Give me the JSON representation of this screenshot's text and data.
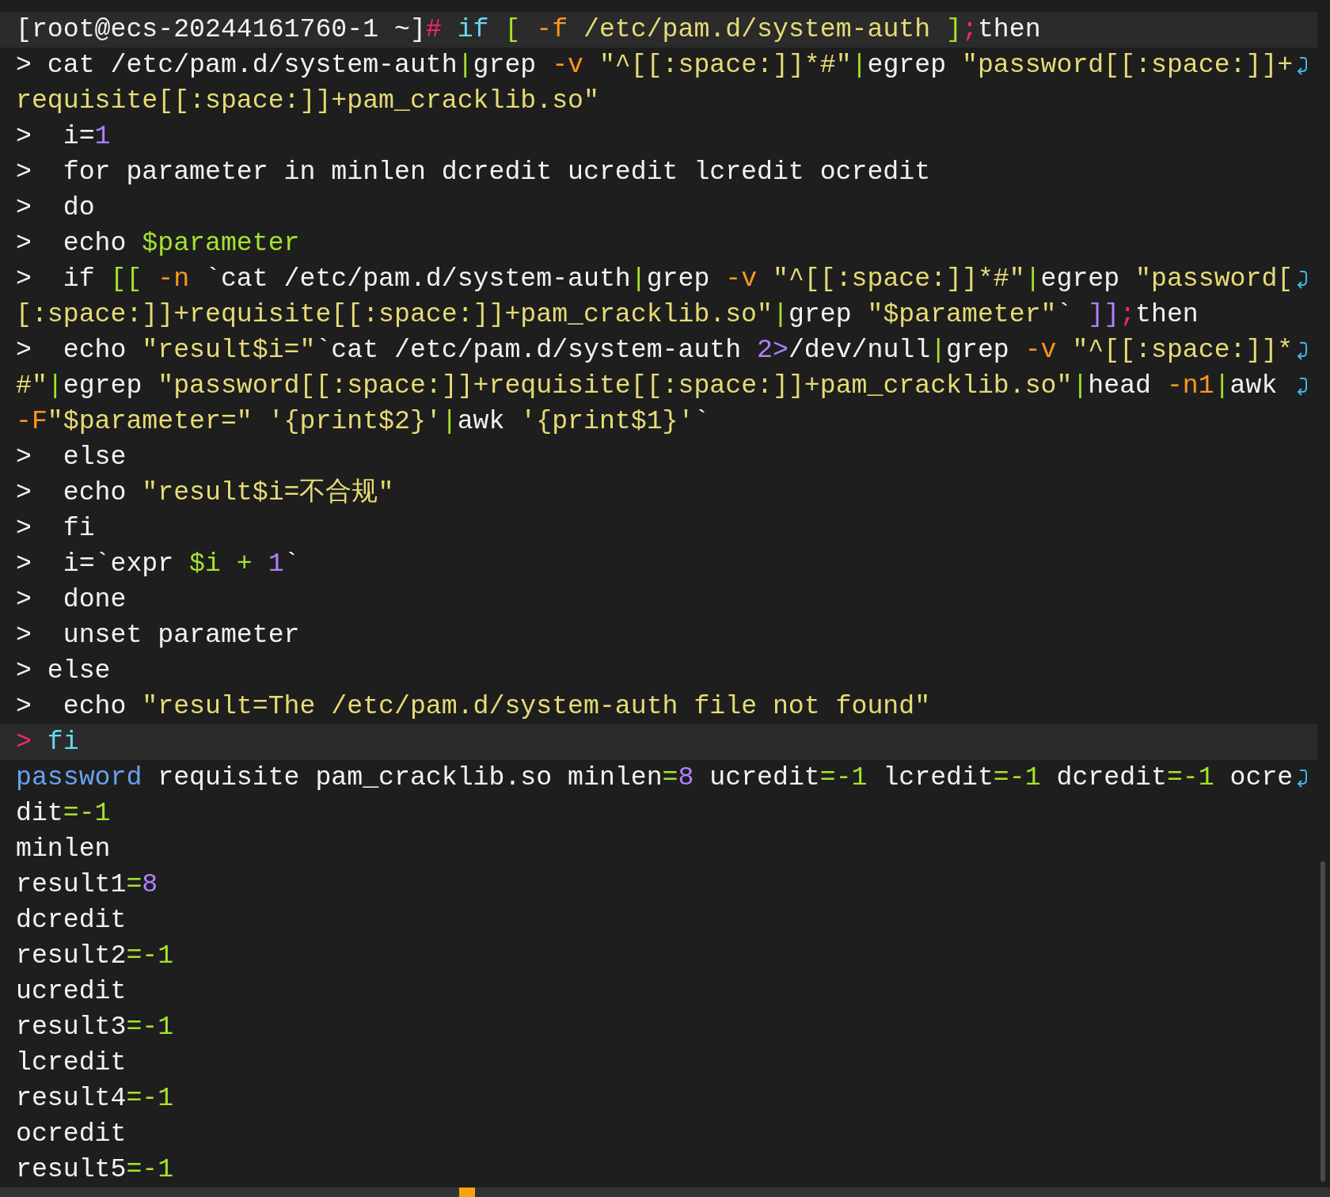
{
  "terminal": {
    "lines": [
      {
        "highlighted": true,
        "wrapped": false,
        "segments": [
          {
            "kind": "text",
            "text": "[root@ecs-20244161760-1 ~]"
          },
          {
            "kind": "punct",
            "text": "# "
          },
          {
            "kind": "keyword",
            "text": "if "
          },
          {
            "kind": "operator",
            "text": "[ "
          },
          {
            "kind": "option",
            "text": "-f "
          },
          {
            "kind": "string",
            "text": "/etc/pam.d/system-auth "
          },
          {
            "kind": "operator",
            "text": "]"
          },
          {
            "kind": "punct",
            "text": ";"
          },
          {
            "kind": "text",
            "text": "then"
          }
        ]
      },
      {
        "highlighted": false,
        "wrapped": true,
        "segments": [
          {
            "kind": "text",
            "text": "> cat /etc/pam.d/system-auth"
          },
          {
            "kind": "operator",
            "text": "|"
          },
          {
            "kind": "text",
            "text": "grep "
          },
          {
            "kind": "option",
            "text": "-v "
          },
          {
            "kind": "string",
            "text": "\"^[[:space:]]*#\""
          },
          {
            "kind": "operator",
            "text": "|"
          },
          {
            "kind": "text",
            "text": "egrep "
          },
          {
            "kind": "string",
            "text": "\"password[[:space:]]+"
          }
        ]
      },
      {
        "highlighted": false,
        "wrapped": false,
        "segments": [
          {
            "kind": "string",
            "text": "requisite[[:space:]]+pam_cracklib.so\""
          }
        ]
      },
      {
        "highlighted": false,
        "wrapped": false,
        "segments": [
          {
            "kind": "text",
            "text": ">  i="
          },
          {
            "kind": "number",
            "text": "1"
          }
        ]
      },
      {
        "highlighted": false,
        "wrapped": false,
        "segments": [
          {
            "kind": "text",
            "text": ">  for parameter in minlen dcredit ucredit lcredit ocredit"
          }
        ]
      },
      {
        "highlighted": false,
        "wrapped": false,
        "segments": [
          {
            "kind": "text",
            "text": ">  do"
          }
        ]
      },
      {
        "highlighted": false,
        "wrapped": false,
        "segments": [
          {
            "kind": "text",
            "text": ">  echo "
          },
          {
            "kind": "operator",
            "text": "$parameter"
          }
        ]
      },
      {
        "highlighted": false,
        "wrapped": true,
        "segments": [
          {
            "kind": "text",
            "text": ">  if "
          },
          {
            "kind": "operator",
            "text": "[[ "
          },
          {
            "kind": "option",
            "text": "-n"
          },
          {
            "kind": "text",
            "text": " `cat /etc/pam.d/system-auth"
          },
          {
            "kind": "operator",
            "text": "|"
          },
          {
            "kind": "text",
            "text": "grep "
          },
          {
            "kind": "option",
            "text": "-v "
          },
          {
            "kind": "string",
            "text": "\"^[[:space:]]*#\""
          },
          {
            "kind": "operator",
            "text": "|"
          },
          {
            "kind": "text",
            "text": "egrep "
          },
          {
            "kind": "string",
            "text": "\"password["
          }
        ]
      },
      {
        "highlighted": false,
        "wrapped": false,
        "segments": [
          {
            "kind": "string",
            "text": "[:space:]]+requisite[[:space:]]+pam_cracklib.so\""
          },
          {
            "kind": "operator",
            "text": "|"
          },
          {
            "kind": "text",
            "text": "grep "
          },
          {
            "kind": "string",
            "text": "\"$parameter\""
          },
          {
            "kind": "text",
            "text": "` "
          },
          {
            "kind": "number",
            "text": "]]"
          },
          {
            "kind": "punct",
            "text": ";"
          },
          {
            "kind": "text",
            "text": "then"
          }
        ]
      },
      {
        "highlighted": false,
        "wrapped": true,
        "segments": [
          {
            "kind": "text",
            "text": ">  echo "
          },
          {
            "kind": "string",
            "text": "\"result$i=\""
          },
          {
            "kind": "text",
            "text": "`cat /etc/pam.d/system-auth "
          },
          {
            "kind": "number",
            "text": "2>"
          },
          {
            "kind": "text",
            "text": "/dev/null"
          },
          {
            "kind": "operator",
            "text": "|"
          },
          {
            "kind": "text",
            "text": "grep "
          },
          {
            "kind": "option",
            "text": "-v "
          },
          {
            "kind": "string",
            "text": "\"^[[:space:]]*"
          }
        ]
      },
      {
        "highlighted": false,
        "wrapped": true,
        "segments": [
          {
            "kind": "string",
            "text": "#\""
          },
          {
            "kind": "operator",
            "text": "|"
          },
          {
            "kind": "text",
            "text": "egrep "
          },
          {
            "kind": "string",
            "text": "\"password[[:space:]]+requisite[[:space:]]+pam_cracklib.so\""
          },
          {
            "kind": "operator",
            "text": "|"
          },
          {
            "kind": "text",
            "text": "head "
          },
          {
            "kind": "option",
            "text": "-n1"
          },
          {
            "kind": "operator",
            "text": "|"
          },
          {
            "kind": "text",
            "text": "awk"
          }
        ]
      },
      {
        "highlighted": false,
        "wrapped": false,
        "segments": [
          {
            "kind": "option",
            "text": "-F"
          },
          {
            "kind": "string",
            "text": "\"$parameter=\" "
          },
          {
            "kind": "string",
            "text": "'{print$2}'"
          },
          {
            "kind": "operator",
            "text": "|"
          },
          {
            "kind": "text",
            "text": "awk "
          },
          {
            "kind": "string",
            "text": "'{print$1}'"
          },
          {
            "kind": "text",
            "text": "`"
          }
        ]
      },
      {
        "highlighted": false,
        "wrapped": false,
        "segments": [
          {
            "kind": "text",
            "text": ">  else"
          }
        ]
      },
      {
        "highlighted": false,
        "wrapped": false,
        "segments": [
          {
            "kind": "text",
            "text": ">  echo "
          },
          {
            "kind": "string",
            "text": "\"result$i=不合规\""
          }
        ]
      },
      {
        "highlighted": false,
        "wrapped": false,
        "segments": [
          {
            "kind": "text",
            "text": ">  fi"
          }
        ]
      },
      {
        "highlighted": false,
        "wrapped": false,
        "segments": [
          {
            "kind": "text",
            "text": ">  i=`expr "
          },
          {
            "kind": "operator",
            "text": "$i "
          },
          {
            "kind": "operator",
            "text": "+ "
          },
          {
            "kind": "number",
            "text": "1"
          },
          {
            "kind": "text",
            "text": "`"
          }
        ]
      },
      {
        "highlighted": false,
        "wrapped": false,
        "segments": [
          {
            "kind": "text",
            "text": ">  done"
          }
        ]
      },
      {
        "highlighted": false,
        "wrapped": false,
        "segments": [
          {
            "kind": "text",
            "text": ">  unset parameter"
          }
        ]
      },
      {
        "highlighted": false,
        "wrapped": false,
        "segments": [
          {
            "kind": "text",
            "text": "> else"
          }
        ]
      },
      {
        "highlighted": false,
        "wrapped": false,
        "segments": [
          {
            "kind": "text",
            "text": ">  echo "
          },
          {
            "kind": "string",
            "text": "\"result=The /etc/pam.d/system-auth file not found\""
          }
        ]
      },
      {
        "highlighted": true,
        "wrapped": false,
        "segments": [
          {
            "kind": "punct",
            "text": "> "
          },
          {
            "kind": "keyword",
            "text": "fi"
          }
        ]
      },
      {
        "highlighted": false,
        "wrapped": true,
        "segments": [
          {
            "kind": "builtin",
            "text": "password"
          },
          {
            "kind": "text",
            "text": " requisite pam_cracklib.so minlen"
          },
          {
            "kind": "operator",
            "text": "="
          },
          {
            "kind": "number",
            "text": "8"
          },
          {
            "kind": "text",
            "text": " ucredit"
          },
          {
            "kind": "operator",
            "text": "=-1"
          },
          {
            "kind": "text",
            "text": " lcredit"
          },
          {
            "kind": "operator",
            "text": "=-1"
          },
          {
            "kind": "text",
            "text": " dcredit"
          },
          {
            "kind": "operator",
            "text": "=-1"
          },
          {
            "kind": "text",
            "text": " ocre"
          }
        ]
      },
      {
        "highlighted": false,
        "wrapped": false,
        "segments": [
          {
            "kind": "text",
            "text": "dit"
          },
          {
            "kind": "operator",
            "text": "=-1"
          }
        ]
      },
      {
        "highlighted": false,
        "wrapped": false,
        "segments": [
          {
            "kind": "text",
            "text": "minlen"
          }
        ]
      },
      {
        "highlighted": false,
        "wrapped": false,
        "segments": [
          {
            "kind": "text",
            "text": "result1"
          },
          {
            "kind": "operator",
            "text": "="
          },
          {
            "kind": "number",
            "text": "8"
          }
        ]
      },
      {
        "highlighted": false,
        "wrapped": false,
        "segments": [
          {
            "kind": "text",
            "text": "dcredit"
          }
        ]
      },
      {
        "highlighted": false,
        "wrapped": false,
        "segments": [
          {
            "kind": "text",
            "text": "result2"
          },
          {
            "kind": "operator",
            "text": "=-1"
          }
        ]
      },
      {
        "highlighted": false,
        "wrapped": false,
        "segments": [
          {
            "kind": "text",
            "text": "ucredit"
          }
        ]
      },
      {
        "highlighted": false,
        "wrapped": false,
        "segments": [
          {
            "kind": "text",
            "text": "result3"
          },
          {
            "kind": "operator",
            "text": "=-1"
          }
        ]
      },
      {
        "highlighted": false,
        "wrapped": false,
        "segments": [
          {
            "kind": "text",
            "text": "lcredit"
          }
        ]
      },
      {
        "highlighted": false,
        "wrapped": false,
        "segments": [
          {
            "kind": "text",
            "text": "result4"
          },
          {
            "kind": "operator",
            "text": "=-1"
          }
        ]
      },
      {
        "highlighted": false,
        "wrapped": false,
        "segments": [
          {
            "kind": "text",
            "text": "ocredit"
          }
        ]
      },
      {
        "highlighted": false,
        "wrapped": false,
        "segments": [
          {
            "kind": "text",
            "text": "result5"
          },
          {
            "kind": "operator",
            "text": "=-1"
          }
        ]
      }
    ]
  }
}
